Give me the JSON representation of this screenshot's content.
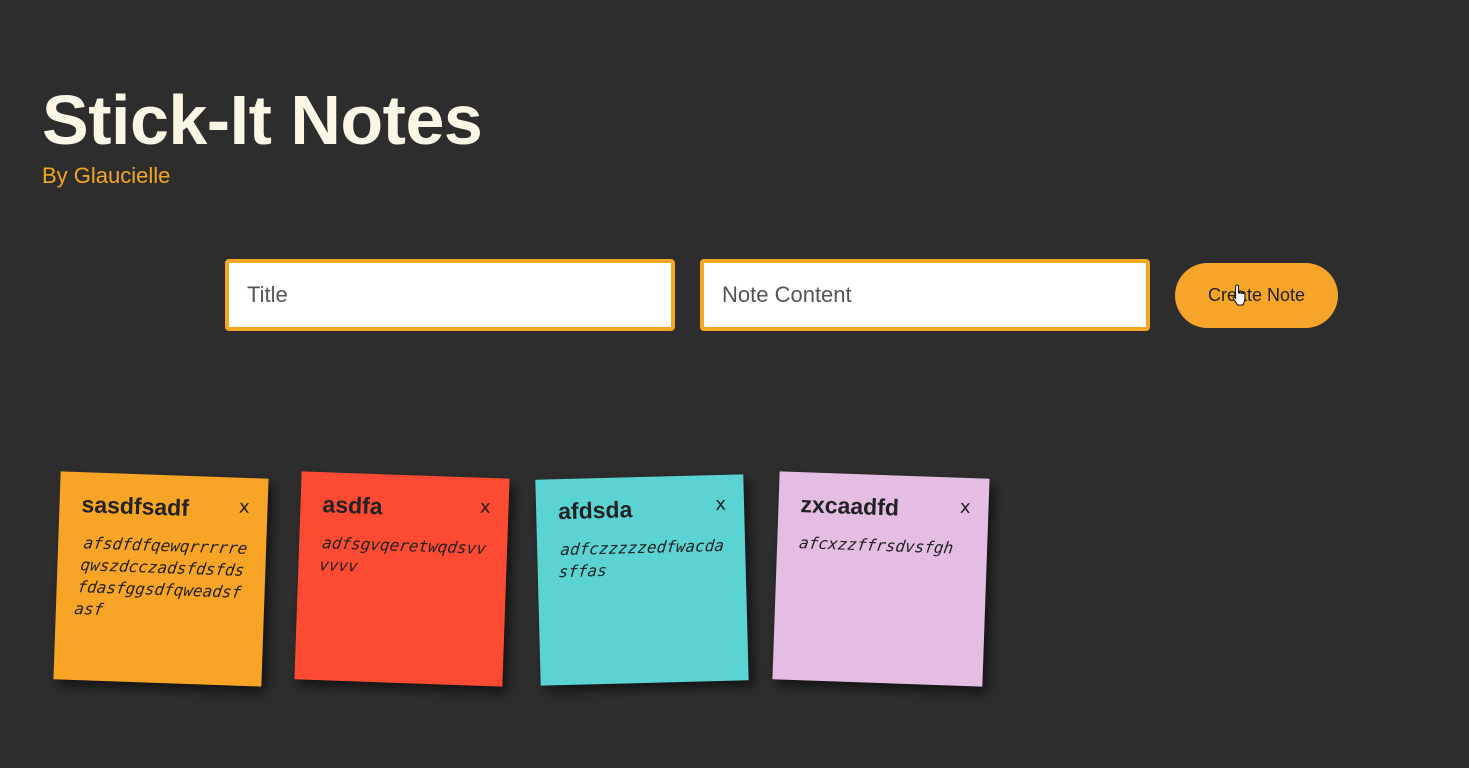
{
  "header": {
    "title": "Stick-It Notes",
    "subtitle": "By Glaucielle"
  },
  "form": {
    "title_placeholder": "Title",
    "title_value": "",
    "content_placeholder": "Note Content",
    "content_value": "",
    "create_button_label": "Create Note"
  },
  "notes": [
    {
      "title": "sasdfsadf",
      "body": "afsdfdfqewqrrrrre qwszdcczadsfdsfds fdasfggsdfqweadsf asf",
      "close_label": "x",
      "color": "#f8a426"
    },
    {
      "title": "asdfa",
      "body": "adfsgvqeretwqdsvv vvvv",
      "close_label": "x",
      "color": "#fd4b33"
    },
    {
      "title": "afdsda",
      "body": "adfczzzzzedfwacda sffas",
      "close_label": "x",
      "color": "#5bd3d2"
    },
    {
      "title": "zxcaadfd",
      "body": "afcxzzffrsdvsfgh",
      "close_label": "x",
      "color": "#e4bde3"
    }
  ],
  "icons": {
    "cursor": "hand-pointer-icon"
  }
}
